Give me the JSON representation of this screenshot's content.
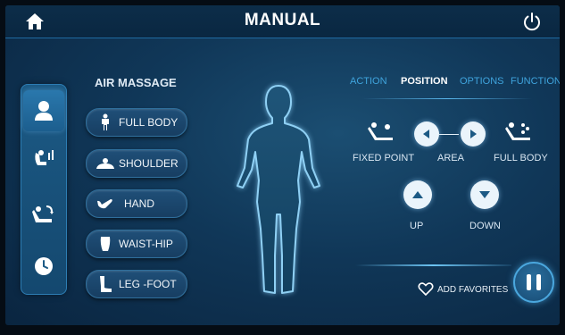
{
  "header": {
    "title": "MANUAL",
    "home_icon": "home-icon",
    "power_icon": "power-icon"
  },
  "sidebar": {
    "items": [
      {
        "icon": "person-icon",
        "active": true
      },
      {
        "icon": "chair-user-icon",
        "active": false
      },
      {
        "icon": "recline-icon",
        "active": false
      },
      {
        "icon": "clock-icon",
        "active": false
      }
    ]
  },
  "air_massage": {
    "title": "AIR MASSAGE",
    "buttons": [
      {
        "label": "FULL BODY",
        "icon": "full-body-icon"
      },
      {
        "label": "SHOULDER",
        "icon": "shoulder-icon"
      },
      {
        "label": "HAND",
        "icon": "hand-icon"
      },
      {
        "label": "WAIST-HIP",
        "icon": "waist-hip-icon"
      },
      {
        "label": "LEG -FOOT",
        "icon": "leg-foot-icon"
      }
    ]
  },
  "tabs": [
    {
      "label": "ACTION",
      "active": false
    },
    {
      "label": "POSITION",
      "active": true
    },
    {
      "label": "OPTIONS",
      "active": false
    },
    {
      "label": "FUNCTION",
      "active": false
    }
  ],
  "position": {
    "fixed_point": "FIXED POINT",
    "area": "AREA",
    "full_body": "FULL BODY",
    "up": "UP",
    "down": "DOWN"
  },
  "footer": {
    "add_favorites": "ADD FAVORITES",
    "pause_icon": "pause-icon"
  },
  "colors": {
    "accent": "#3fa4dd",
    "background": "#103758",
    "button_fill": "#1f4f78"
  }
}
